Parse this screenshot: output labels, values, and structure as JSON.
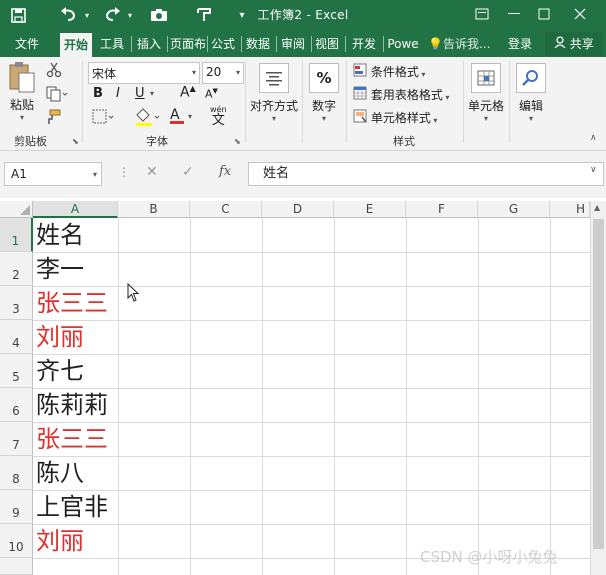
{
  "titlebar": {
    "title": "工作簿2 - Excel",
    "window_controls": [
      "restore-icon",
      "minimize-icon",
      "maximize-icon",
      "close-icon"
    ]
  },
  "ribbon_tabs": [
    "文件",
    "开始",
    "工具",
    "插入",
    "页面布",
    "公式",
    "数据",
    "审阅",
    "视图",
    "开发工",
    "Powe"
  ],
  "active_tab": "开始",
  "tell_me": "告诉我...",
  "signin": "登录",
  "share": "共享",
  "clipboard": {
    "paste": "粘贴",
    "group": "剪贴板"
  },
  "font": {
    "name": "宋体",
    "size": "20",
    "bold": "B",
    "italic": "I",
    "underline": "U",
    "grow": "A",
    "shrink": "A",
    "color_letter": "A",
    "wen": "wén",
    "wen_char": "文",
    "group": "字体"
  },
  "alignment": {
    "label": "对齐方式"
  },
  "number": {
    "label": "数字",
    "symbol": "%"
  },
  "styles": {
    "conditional": "条件格式",
    "table": "套用表格格式",
    "cell_styles": "单元格样式",
    "group": "样式"
  },
  "cells": {
    "label": "单元格"
  },
  "editing": {
    "label": "编辑"
  },
  "formula_bar": {
    "name_box": "A1",
    "fx": "fx",
    "content": "姓名"
  },
  "columns": [
    "A",
    "B",
    "C",
    "D",
    "E",
    "F",
    "G",
    "H"
  ],
  "rows": [
    "1",
    "2",
    "3",
    "4",
    "5",
    "6",
    "7",
    "8",
    "9",
    "10"
  ],
  "column_a": [
    {
      "value": "姓名",
      "color": "#222222"
    },
    {
      "value": "李一",
      "color": "#222222"
    },
    {
      "value": "张三三",
      "color": "#e0302c"
    },
    {
      "value": "刘丽",
      "color": "#e0302c"
    },
    {
      "value": "齐七",
      "color": "#222222"
    },
    {
      "value": "陈莉莉",
      "color": "#222222"
    },
    {
      "value": "张三三",
      "color": "#e0302c"
    },
    {
      "value": "陈八",
      "color": "#222222"
    },
    {
      "value": "上官非",
      "color": "#222222"
    },
    {
      "value": "刘丽",
      "color": "#e0302c"
    }
  ],
  "watermark": "CSDN @小呀小兔兔",
  "colors": {
    "excel_green": "#217346",
    "duplicate_red": "#e0302c"
  }
}
